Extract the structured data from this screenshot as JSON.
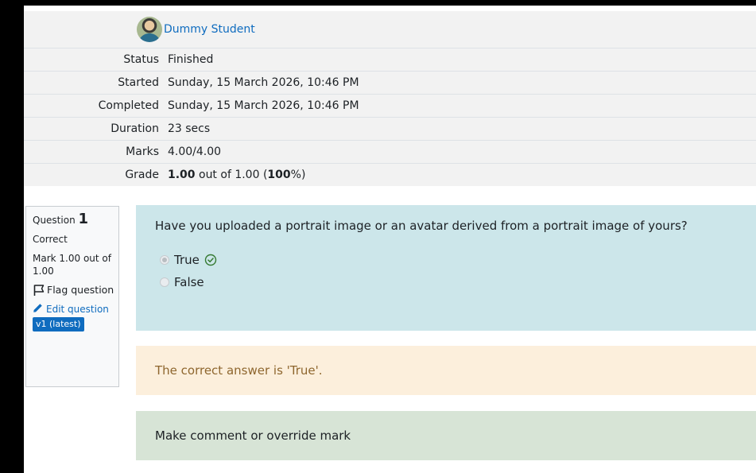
{
  "summary": {
    "user_name": "Dummy Student",
    "rows": [
      {
        "label": "Status",
        "value": "Finished"
      },
      {
        "label": "Started",
        "value": "Sunday, 15 March 2026, 10:46 PM"
      },
      {
        "label": "Completed",
        "value": "Sunday, 15 March 2026, 10:46 PM"
      },
      {
        "label": "Duration",
        "value": "23 secs"
      },
      {
        "label": "Marks",
        "value": "4.00/4.00"
      }
    ],
    "grade": {
      "label": "Grade",
      "score": "1.00",
      "middle": " out of 1.00 (",
      "percent": "100",
      "percent_sign": "%",
      "end": ")"
    }
  },
  "question": {
    "prefix": "Question",
    "number": "1",
    "state": "Correct",
    "mark": "Mark 1.00 out of 1.00",
    "flag_label": "Flag question",
    "edit_label": "Edit question",
    "version_badge": "v1 (latest)",
    "text": "Have you uploaded a portrait image or an avatar derived from a portrait image of yours?",
    "answers": [
      {
        "label": "True",
        "checked": true
      },
      {
        "label": "False",
        "checked": false
      }
    ],
    "feedback": "The correct answer is 'True'.",
    "comment_link": "Make comment or override mark"
  },
  "colors": {
    "link": "#0f6cbf",
    "formulation_bg": "#cce6ea",
    "outcome_bg": "#fcefdc",
    "comment_bg": "#d7e4d6",
    "correct_green": "#357a32"
  }
}
